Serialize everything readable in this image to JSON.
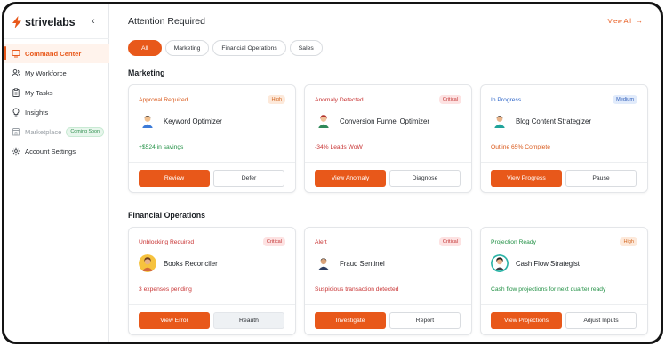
{
  "brand": {
    "name": "strivelabs",
    "accent": "#e8581a"
  },
  "sidebar": {
    "collapse_icon": "chevron-left-icon",
    "items": [
      {
        "label": "Command Center",
        "icon": "command-center-icon",
        "active": true
      },
      {
        "label": "My Workforce",
        "icon": "users-icon"
      },
      {
        "label": "My Tasks",
        "icon": "clipboard-icon"
      },
      {
        "label": "Insights",
        "icon": "lightbulb-icon"
      },
      {
        "label": "Marketplace",
        "icon": "store-icon",
        "badge": "Coming Soon",
        "disabled": true
      },
      {
        "label": "Account Settings",
        "icon": "gear-icon"
      }
    ]
  },
  "header": {
    "title": "Attention Required",
    "view_all": "View All",
    "view_all_icon": "arrow-right-icon"
  },
  "filters": [
    "All",
    "Marketing",
    "Financial Operations",
    "Sales"
  ],
  "sections": [
    {
      "title": "Marketing",
      "cards": [
        {
          "status": "Approval Required",
          "badge": "High",
          "agent": "Keyword Optimizer",
          "metric": "+$524 in savings",
          "primary": "Review",
          "secondary": "Defer"
        },
        {
          "status": "Anomaly Detected",
          "badge": "Critical",
          "agent": "Conversion Funnel Optimizer",
          "metric": "-34% Leads WoW",
          "primary": "View Anomaly",
          "secondary": "Diagnose"
        },
        {
          "status": "In Progress",
          "badge": "Medium",
          "agent": "Blog Content Strategizer",
          "metric": "Outline 65% Complete",
          "primary": "View Progress",
          "secondary": "Pause"
        }
      ]
    },
    {
      "title": "Financial Operations",
      "cards": [
        {
          "status": "Unblocking Required",
          "badge": "Critical",
          "agent": "Books Reconciler",
          "metric": "3 expenses pending",
          "primary": "View Error",
          "secondary": "Reauth"
        },
        {
          "status": "Alert",
          "badge": "Critical",
          "agent": "Fraud Sentinel",
          "metric": "Suspicious transaction detected",
          "primary": "Investigate",
          "secondary": "Report"
        },
        {
          "status": "Projection Ready",
          "badge": "High",
          "agent": "Cash Flow Strategist",
          "metric": "Cash flow projections for next quarter ready",
          "primary": "View Projections",
          "secondary": "Adjust Inputs"
        }
      ]
    }
  ]
}
